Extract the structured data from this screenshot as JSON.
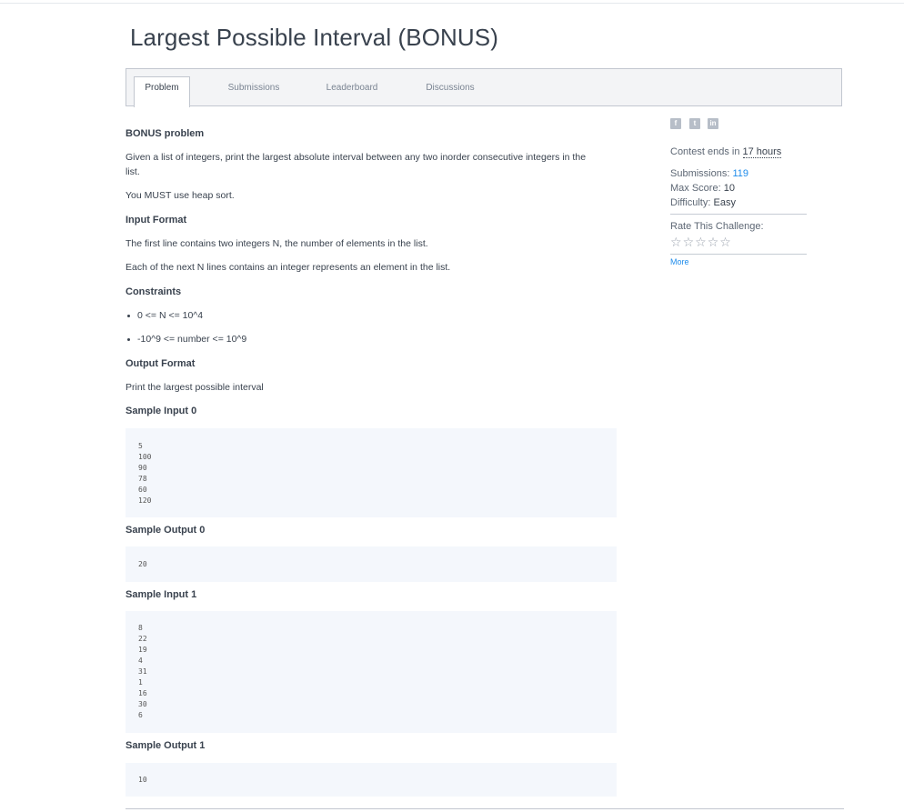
{
  "page": {
    "title": "Largest Possible Interval (BONUS)"
  },
  "tabs": [
    {
      "label": "Problem",
      "active": true
    },
    {
      "label": "Submissions",
      "active": false
    },
    {
      "label": "Leaderboard",
      "active": false
    },
    {
      "label": "Discussions",
      "active": false
    }
  ],
  "problem": {
    "heading": "BONUS problem",
    "description_line1": "Given a list of integers, print the largest absolute interval between any two inorder consecutive integers in the",
    "description_line2": "list.",
    "requirement": "You MUST use heap sort.",
    "input_format_heading": "Input Format",
    "input_format_line1": "The first line contains two integers N, the number of elements in the list.",
    "input_format_line2": "Each of the next N lines contains an integer represents an element in the list.",
    "constraints_heading": "Constraints",
    "constraints": [
      "0 <= N <= 10^4",
      "-10^9 <= number <= 10^9"
    ],
    "output_format_heading": "Output Format",
    "output_format_text": "Print the largest possible interval",
    "sample_input_0_heading": "Sample Input 0",
    "sample_input_0": [
      "5",
      "100",
      "90",
      "78",
      "60",
      "120"
    ],
    "sample_output_0_heading": "Sample Output 0",
    "sample_output_0": [
      "20"
    ],
    "sample_input_1_heading": "Sample Input 1",
    "sample_input_1": [
      "8",
      "22",
      "19",
      "4",
      "31",
      "1",
      "16",
      "30",
      "6"
    ],
    "sample_output_1_heading": "Sample Output 1",
    "sample_output_1": [
      "10"
    ]
  },
  "sidebar": {
    "social_icons": [
      "facebook-icon",
      "twitter-icon",
      "linkedin-icon"
    ],
    "contest_ends_label": "Contest ends in",
    "contest_ends_value": "17 hours",
    "submissions_label": "Submissions:",
    "submissions_value": "119",
    "max_score_label": "Max Score:",
    "max_score_value": "10",
    "difficulty_label": "Difficulty:",
    "difficulty_value": "Easy",
    "rate_label": "Rate This Challenge:",
    "rating_stars": 0,
    "rating_max": 5,
    "more_link": "More"
  },
  "colors": {
    "text": "#39424e",
    "link": "#1f8ceb",
    "code_bg": "#f4f7fc",
    "tab_bar_bg": "#f3f4f6"
  }
}
